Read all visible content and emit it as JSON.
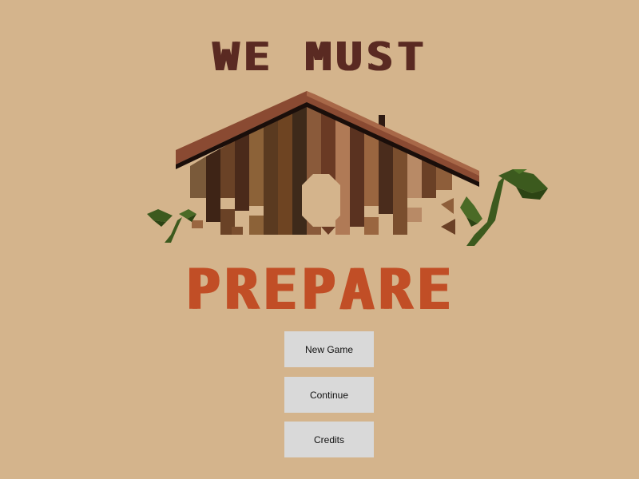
{
  "title": {
    "top": "WE MUST",
    "bottom": "PREPARE"
  },
  "menu": {
    "items": [
      {
        "label": "New Game"
      },
      {
        "label": "Continue"
      },
      {
        "label": "Credits"
      }
    ]
  },
  "colors": {
    "background": "#d4b48c",
    "title_top": "#5a2a22",
    "title_bottom": "#c14e26",
    "button_bg": "#d9d9d9",
    "leaf": "#3c5a1e"
  },
  "art": {
    "icon": "house-with-plants-icon"
  }
}
